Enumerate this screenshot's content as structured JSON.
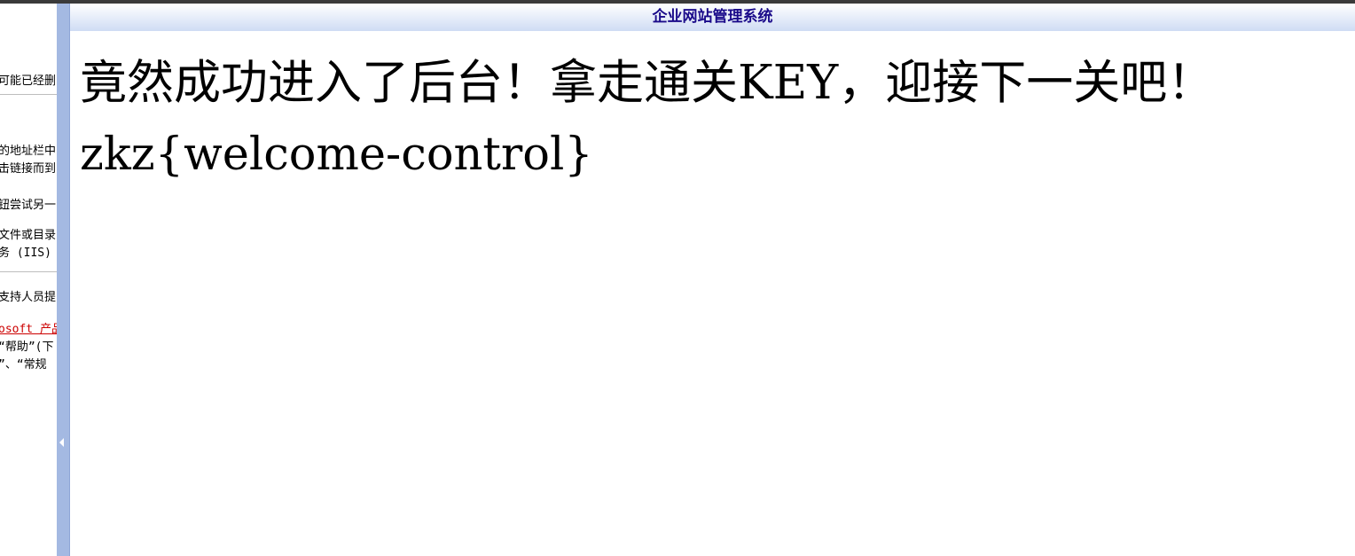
{
  "left_frame": {
    "lines": [
      "可能已经删",
      "的地址栏中",
      "击链接而到",
      "钮尝试另一",
      "文件或目录",
      "务 (IIS)",
      "支持人员提",
      "osoft 产品",
      "“帮助”(下",
      "”、“常规"
    ]
  },
  "main": {
    "title": "企业网站管理系统",
    "message": "竟然成功进入了后台！拿走通关KEY，迎接下一关吧！",
    "flag": "zkz{welcome-control}"
  },
  "colors": {
    "title_text": "#1a0a8a",
    "divider": "#a4b9e2",
    "link": "#cc0000"
  }
}
